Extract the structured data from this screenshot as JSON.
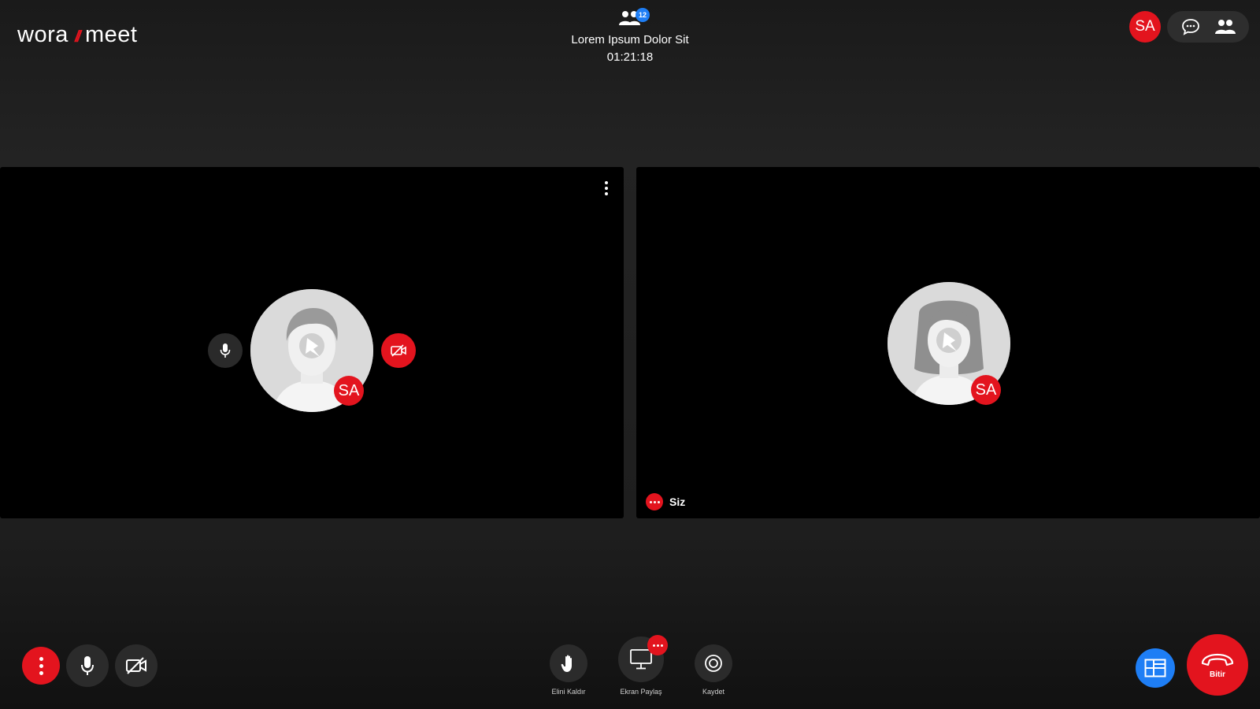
{
  "brand": {
    "name_part1": "wora",
    "separator": "//",
    "name_part2": "meet"
  },
  "meeting": {
    "participant_count": "12",
    "title": "Lorem Ipsum Dolor Sit",
    "timer": "01:21:18"
  },
  "header_right": {
    "user_initials": "SA",
    "chat_icon": "chat-bubble-icon",
    "participants_icon": "people-icon"
  },
  "tiles": [
    {
      "initials": "SA",
      "avatar": "male-placeholder",
      "mic_icon": "microphone-icon",
      "camera_icon": "camera-off-icon",
      "menu_icon": "more-vertical-icon"
    },
    {
      "initials": "SA",
      "avatar": "female-placeholder",
      "name_label": "Siz"
    }
  ],
  "toolbar": {
    "left": {
      "more_icon": "more-vertical-icon",
      "mic_icon": "microphone-icon",
      "camera_icon": "camera-off-icon"
    },
    "center": {
      "raise_hand_label": "Elini Kaldır",
      "share_screen_label": "Ekran Paylaş",
      "record_label": "Kaydet"
    },
    "right": {
      "layout_icon": "grid-layout-icon",
      "end_label": "Bitir"
    }
  },
  "colors": {
    "accent_red": "#e3141e",
    "accent_blue": "#1e7ef5",
    "tile_bg": "#000000",
    "button_bg": "#2b2b2b"
  }
}
